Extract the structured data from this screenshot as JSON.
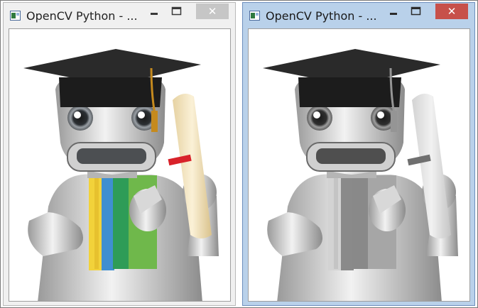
{
  "windows": [
    {
      "id": "color",
      "title": "OpenCV Python - ...",
      "state": "inactive",
      "close_label": "✕",
      "image": "robot-graduate-color"
    },
    {
      "id": "gray",
      "title": "OpenCV Python - ...",
      "state": "active",
      "close_label": "✕",
      "image": "robot-graduate-grayscale"
    }
  ],
  "colors": {
    "active_frame": "#b9d1ea",
    "inactive_frame": "#f0f0f0",
    "close_active": "#c7504a",
    "close_inactive": "#c6c6c6"
  }
}
